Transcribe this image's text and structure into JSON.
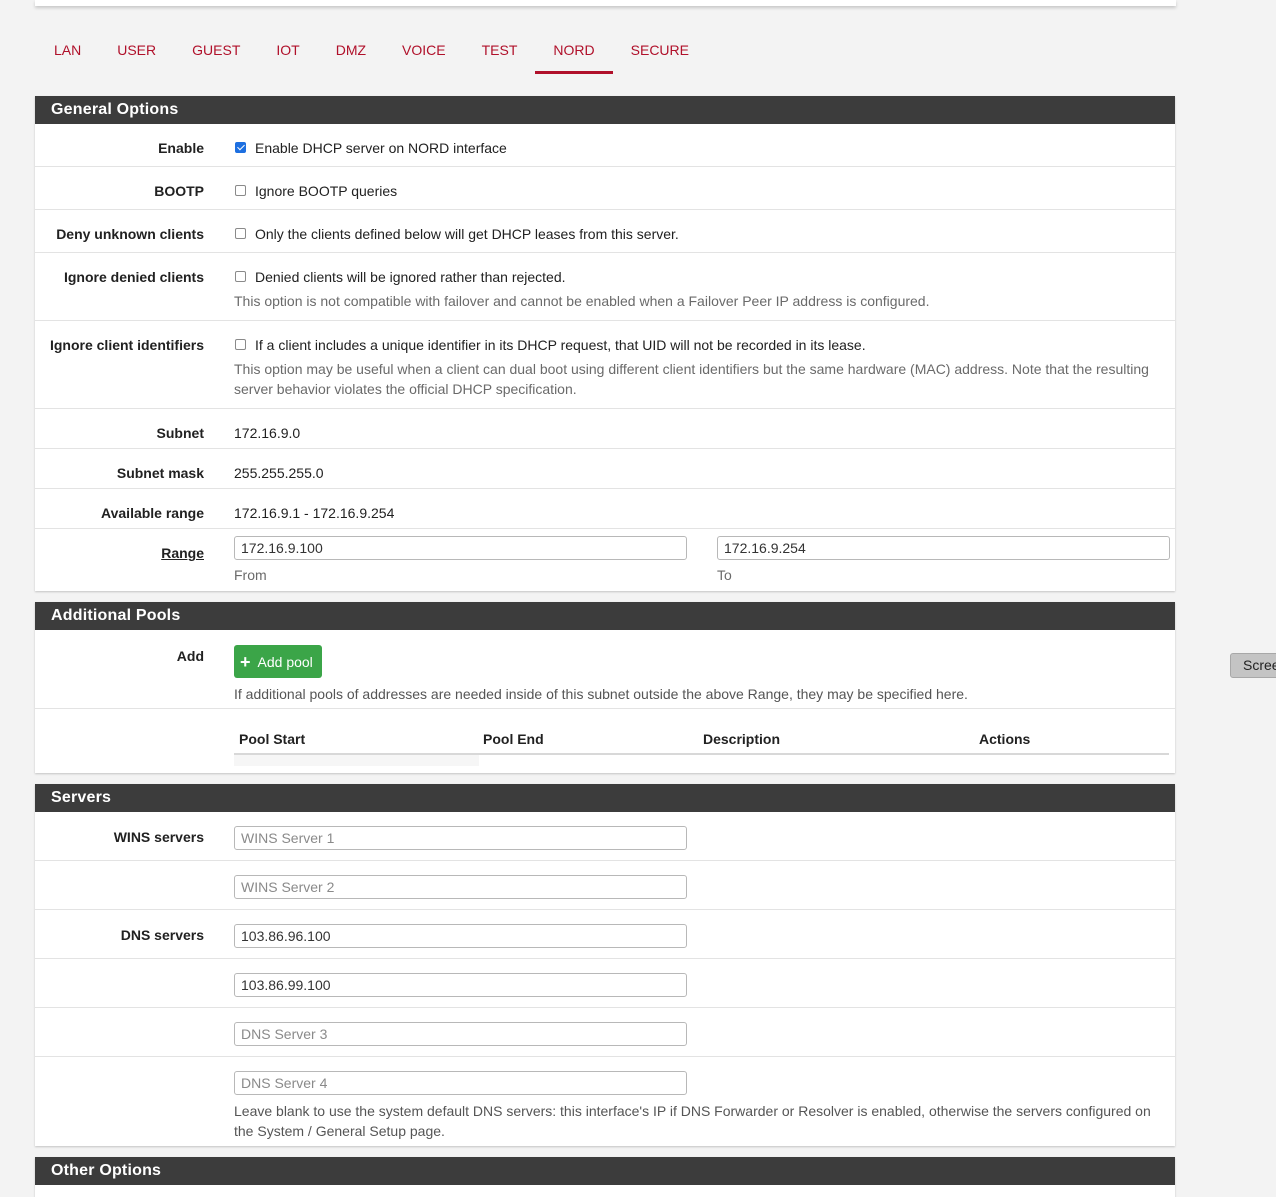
{
  "tabs": [
    {
      "label": "LAN"
    },
    {
      "label": "USER"
    },
    {
      "label": "GUEST"
    },
    {
      "label": "IOT"
    },
    {
      "label": "DMZ"
    },
    {
      "label": "VOICE"
    },
    {
      "label": "TEST"
    },
    {
      "label": "NORD"
    },
    {
      "label": "SECURE"
    }
  ],
  "active_tab": "NORD",
  "general": {
    "heading": "General Options",
    "enable": {
      "label": "Enable",
      "text": "Enable DHCP server on NORD interface",
      "checked": true
    },
    "bootp": {
      "label": "BOOTP",
      "text": "Ignore BOOTP queries",
      "checked": false
    },
    "deny": {
      "label": "Deny unknown clients",
      "text": "Only the clients defined below will get DHCP leases from this server.",
      "checked": false
    },
    "ignore_denied": {
      "label": "Ignore denied clients",
      "text": "Denied clients will be ignored rather than rejected.",
      "help": "This option is not compatible with failover and cannot be enabled when a Failover Peer IP address is configured.",
      "checked": false
    },
    "ignore_ids": {
      "label": "Ignore client identifiers",
      "text": "If a client includes a unique identifier in its DHCP request, that UID will not be recorded in its lease.",
      "help": "This option may be useful when a client can dual boot using different client identifiers but the same hardware (MAC) address. Note that the resulting server behavior violates the official DHCP specification.",
      "checked": false
    },
    "subnet": {
      "label": "Subnet",
      "value": "172.16.9.0"
    },
    "mask": {
      "label": "Subnet mask",
      "value": "255.255.255.0"
    },
    "available": {
      "label": "Available range",
      "value": "172.16.9.1 - 172.16.9.254"
    },
    "range": {
      "label": "Range",
      "from_value": "172.16.9.100",
      "to_value": "172.16.9.254",
      "from_label": "From",
      "to_label": "To"
    }
  },
  "pools": {
    "heading": "Additional Pools",
    "add_label": "Add",
    "add_button": "Add pool",
    "help": "If additional pools of addresses are needed inside of this subnet outside the above Range, they may be specified here.",
    "columns": [
      "Pool Start",
      "Pool End",
      "Description",
      "Actions"
    ]
  },
  "servers": {
    "heading": "Servers",
    "wins_label": "WINS servers",
    "wins1_placeholder": "WINS Server 1",
    "wins2_placeholder": "WINS Server 2",
    "dns_label": "DNS servers",
    "dns1": "103.86.96.100",
    "dns2": "103.86.99.100",
    "dns3_placeholder": "DNS Server 3",
    "dns4_placeholder": "DNS Server 4",
    "dns_help": "Leave blank to use the system default DNS servers: this interface's IP if DNS Forwarder or Resolver is enabled, otherwise the servers configured on the System / General Setup page."
  },
  "other": {
    "heading": "Other Options"
  },
  "side_button": "Scree",
  "colors": {
    "accent": "#b0102a",
    "heading_bg": "#3c3c3c",
    "add_button": "#3ba548",
    "checkbox": "#1d6fe0"
  }
}
